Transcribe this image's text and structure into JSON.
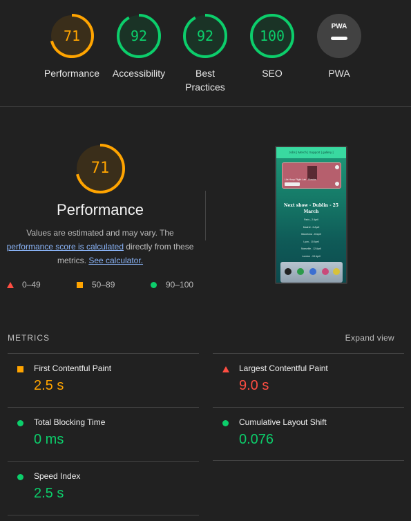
{
  "scores": [
    {
      "label": "Performance",
      "value": "71",
      "fraction": 0.71,
      "color": "#ffa400"
    },
    {
      "label": "Accessibility",
      "value": "92",
      "fraction": 0.92,
      "color": "#0cce6b"
    },
    {
      "label": "Best Practices",
      "value": "92",
      "fraction": 0.92,
      "color": "#0cce6b"
    },
    {
      "label": "SEO",
      "value": "100",
      "fraction": 1.0,
      "color": "#0cce6b"
    },
    {
      "label": "PWA",
      "value": "PWA",
      "color": "#9e9e9e"
    }
  ],
  "performance": {
    "score": "71",
    "fraction": 0.71,
    "title": "Performance",
    "desc_before": "Values are estimated and may vary. The",
    "desc_link1": "performance score is calculated",
    "desc_middle": "directly from these metrics.",
    "desc_link2": "See calculator."
  },
  "legend": [
    {
      "range": "0–49",
      "icon": "red-triangle-icon",
      "color": "#ff4e42"
    },
    {
      "range": "50–89",
      "icon": "orange-square-icon",
      "color": "#ffa400"
    },
    {
      "range": "90–100",
      "icon": "green-circle-icon",
      "color": "#0cce6b"
    }
  ],
  "thumbnail": {
    "nav": "Jobs | Merch | Support | gallery |",
    "card_caption": "Lila Hoop Flight Lab - Bonoke",
    "headline": "Next show - Dublin - 25 March",
    "cities": [
      "Paris - 2 April",
      "Madrid - 6 April",
      "Barcelona - 8 April",
      "Lyon - 10 April",
      "Marseille - 12 April",
      "London - 15 April",
      "Manchester - 18 April"
    ]
  },
  "metrics": {
    "heading": "METRICS",
    "expand_label": "Expand view",
    "items": [
      {
        "name": "First Contentful Paint",
        "value": "2.5 s",
        "status": "orange",
        "icon": "orange-square-icon"
      },
      {
        "name": "Largest Contentful Paint",
        "value": "9.0 s",
        "status": "red",
        "icon": "red-triangle-icon"
      },
      {
        "name": "Total Blocking Time",
        "value": "0 ms",
        "status": "green",
        "icon": "green-circle-icon"
      },
      {
        "name": "Cumulative Layout Shift",
        "value": "0.076",
        "status": "green",
        "icon": "green-circle-icon"
      },
      {
        "name": "Speed Index",
        "value": "2.5 s",
        "status": "green",
        "icon": "green-circle-icon"
      }
    ]
  }
}
